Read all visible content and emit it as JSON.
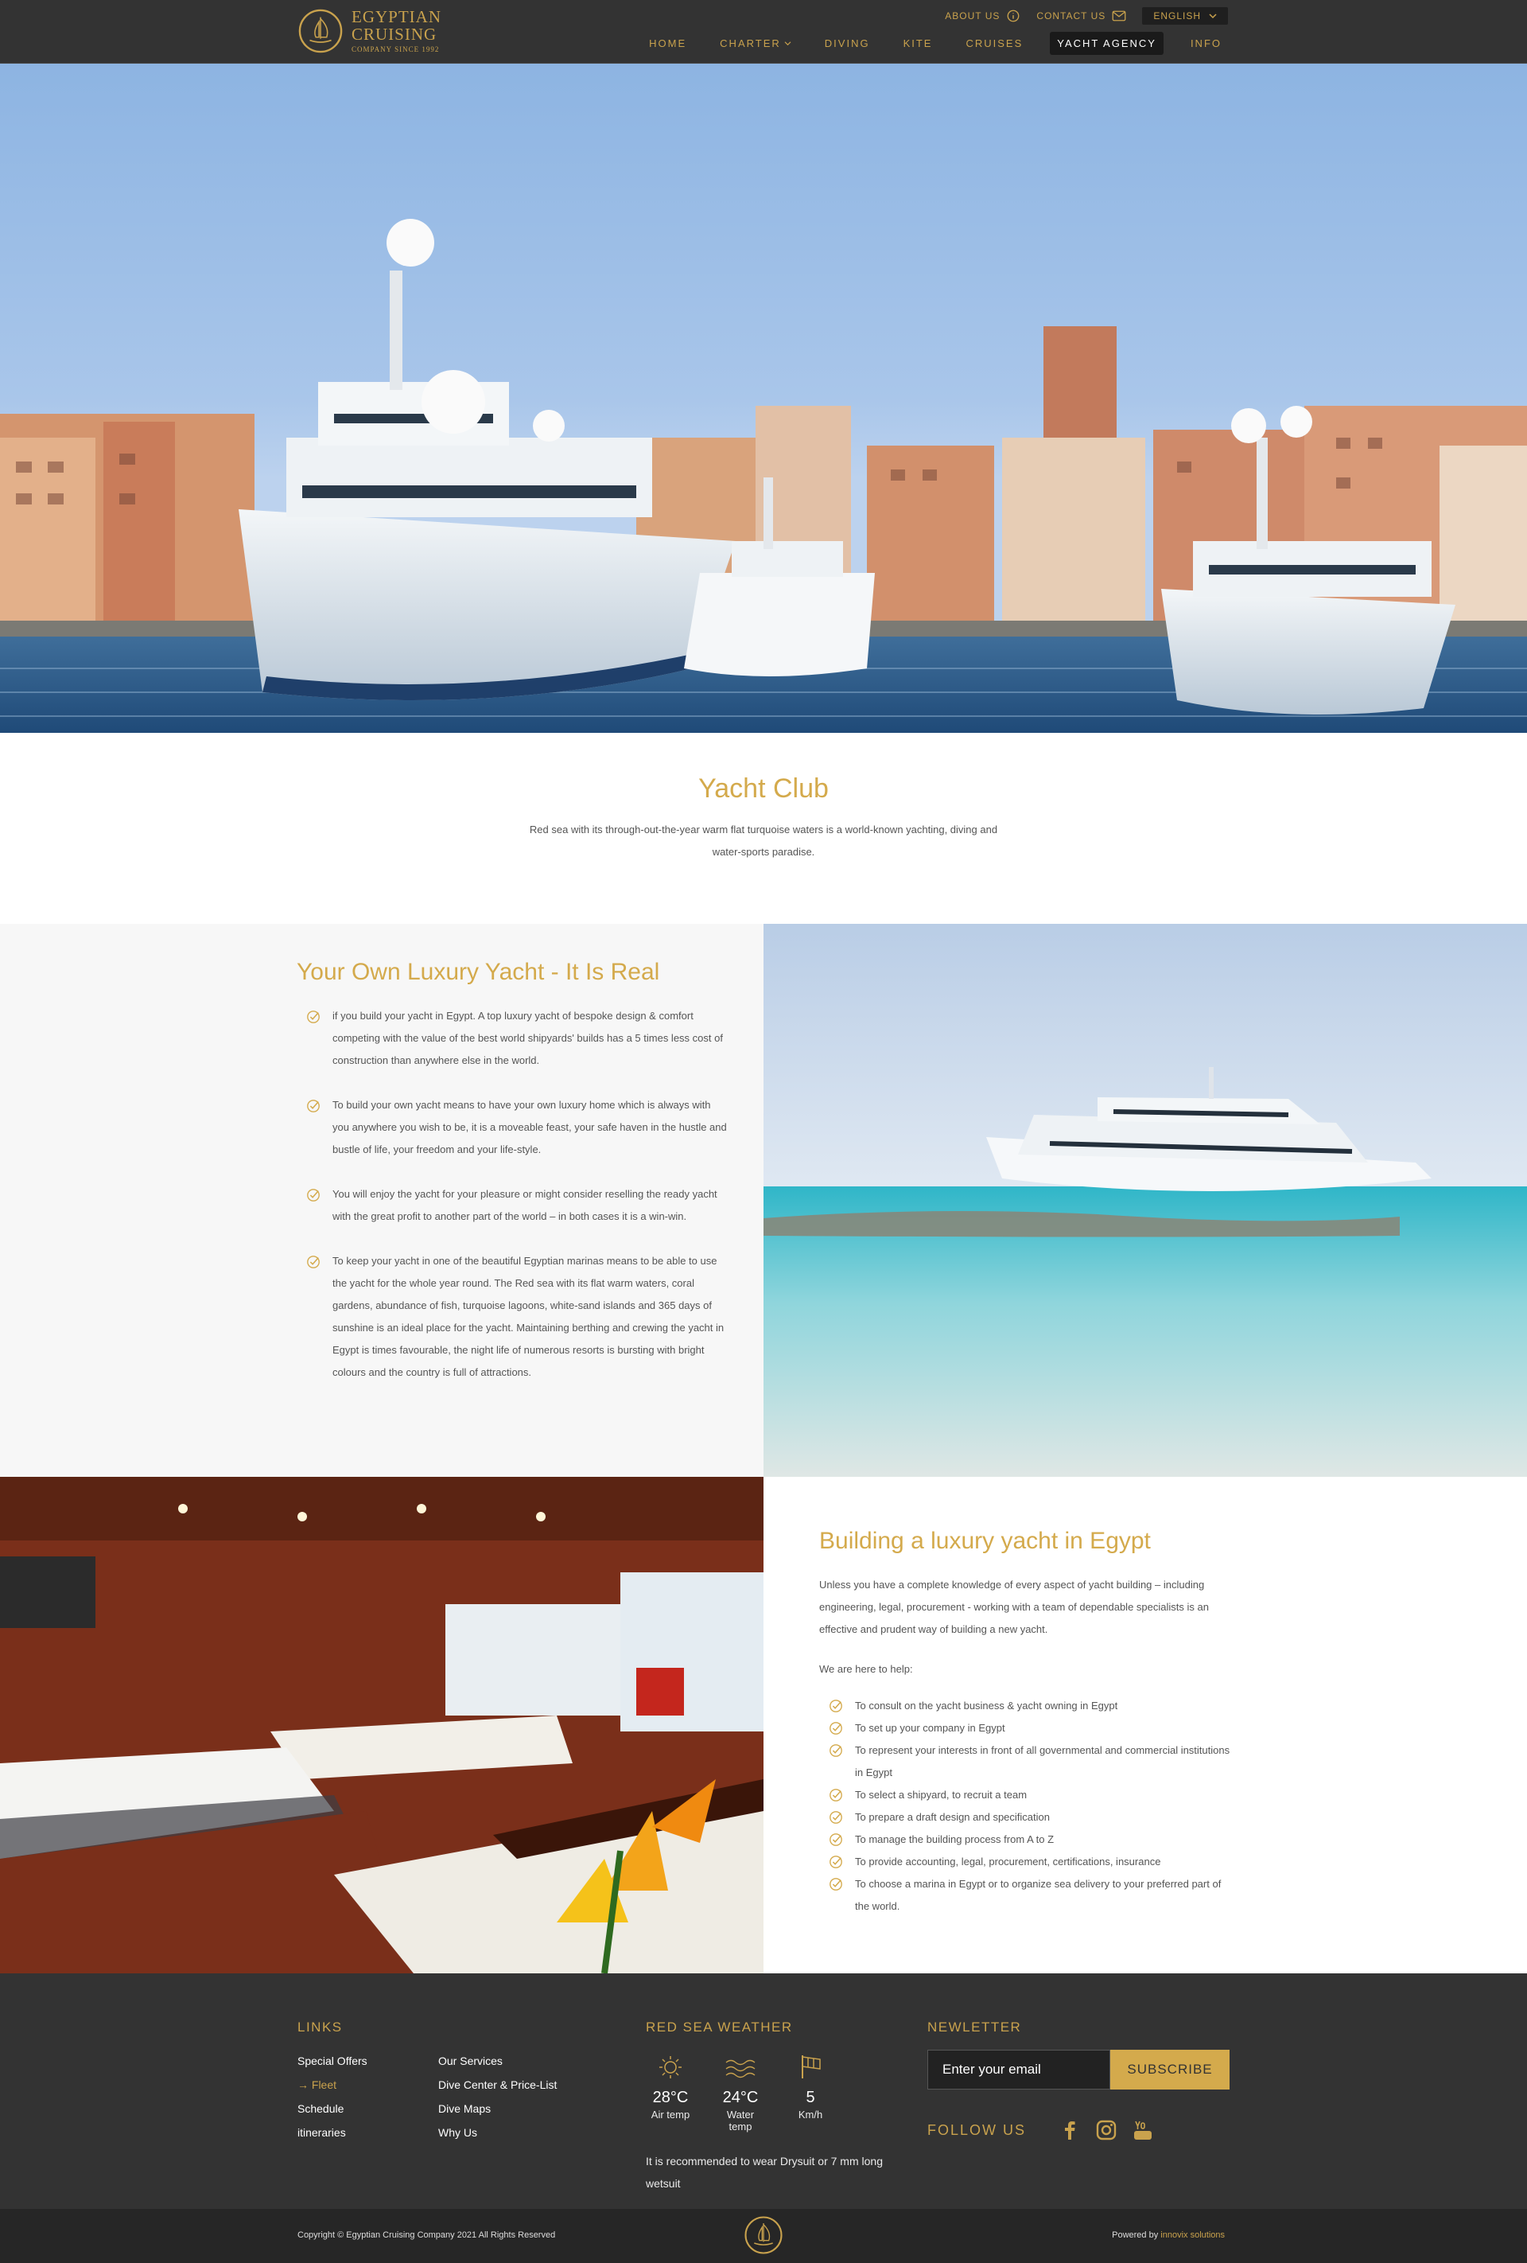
{
  "header": {
    "logo": {
      "line1": "EGYPTIAN",
      "line2": "CRUISING",
      "line3": "COMPANY SINCE 1992"
    },
    "top_links": {
      "about": "ABOUT US",
      "contact": "CONTACT US",
      "language": "ENGLISH"
    },
    "nav": [
      "HOME",
      "CHARTER",
      "DIVING",
      "KITE",
      "CRUISES",
      "YACHT AGENCY",
      "INFO"
    ],
    "active_nav": "YACHT AGENCY"
  },
  "intro": {
    "title": "Yacht Club",
    "text": "Red sea with its through-out-the-year warm flat turquoise waters is a world-known yachting, diving and water-sports paradise."
  },
  "section1": {
    "title": "Your Own Luxury Yacht - It Is Real",
    "items": [
      "if you build your yacht in Egypt. A top luxury yacht of bespoke design & comfort competing with the value of the best world shipyards' builds has a 5 times less cost of construction than anywhere else in the world.",
      "To build your own yacht means to have your own luxury home which is always with you anywhere you wish to be, it is a moveable feast, your safe haven in the hustle and bustle of life, your freedom and your life-style.",
      "You will enjoy the yacht for your pleasure or might consider reselling the ready yacht with the great profit to another part of the world – in both cases it is a win-win.",
      "To keep your yacht in one of the beautiful Egyptian marinas means to be able to use the yacht for the whole year round. The Red sea with its flat warm waters, coral gardens, abundance of fish, turquoise lagoons, white-sand islands and 365 days of sunshine is an ideal place for the yacht. Maintaining berthing and crewing the yacht in Egypt is times favourable, the night life of numerous resorts is bursting with bright colours and the country is full of attractions."
    ]
  },
  "section2": {
    "title": "Building a luxury yacht in Egypt",
    "para1": "Unless you have a complete knowledge of every aspect of yacht building – including engineering, legal, procurement - working with a team of dependable specialists is an effective and prudent way of building a new yacht.",
    "para2": "We are here to help:",
    "items": [
      "To consult on the yacht business & yacht owning in Egypt",
      "To set up your company in Egypt",
      "To represent your interests in front of all governmental and commercial institutions in Egypt",
      "To select a shipyard, to recruit a team",
      "To prepare a draft design and specification",
      "To manage the building process from A to Z",
      "To provide accounting, legal, procurement, certifications, insurance",
      "To choose a marina in Egypt or to organize sea delivery to your preferred part of the world."
    ]
  },
  "footer": {
    "links_title": "LINKS",
    "links_col1": [
      "Special Offers",
      "Fleet",
      "Schedule",
      "itineraries"
    ],
    "links_col2": [
      "Our Services",
      "Dive Center & Price-List",
      "Dive Maps",
      "Why Us"
    ],
    "current_link": "Fleet",
    "weather_title": "RED SEA WEATHER",
    "weather": [
      {
        "value": "28°C",
        "label": "Air temp",
        "icon": "sun-icon"
      },
      {
        "value": "24°C",
        "label": "Water temp",
        "icon": "waves-icon"
      },
      {
        "value": "5",
        "label": "Km/h",
        "icon": "wind-flag-icon"
      }
    ],
    "weather_note": "It is recommended to wear Drysuit or 7 mm long wetsuit",
    "newsletter_title": "NEWLETTER",
    "email_placeholder": "Enter your email",
    "subscribe_label": "SUBSCRIBE",
    "follow_label": "FOLLOW US",
    "social": [
      "facebook-icon",
      "instagram-icon",
      "youtube-icon"
    ]
  },
  "bottom": {
    "copyright": "Copyright © Egyptian Cruising Company 2021 All Rights Reserved",
    "powered_prefix": "Powered by ",
    "powered_brand": "innovix solutions"
  },
  "colors": {
    "gold": "#c9a24d",
    "dark": "#333333",
    "light_bg": "#f7f7f7"
  }
}
